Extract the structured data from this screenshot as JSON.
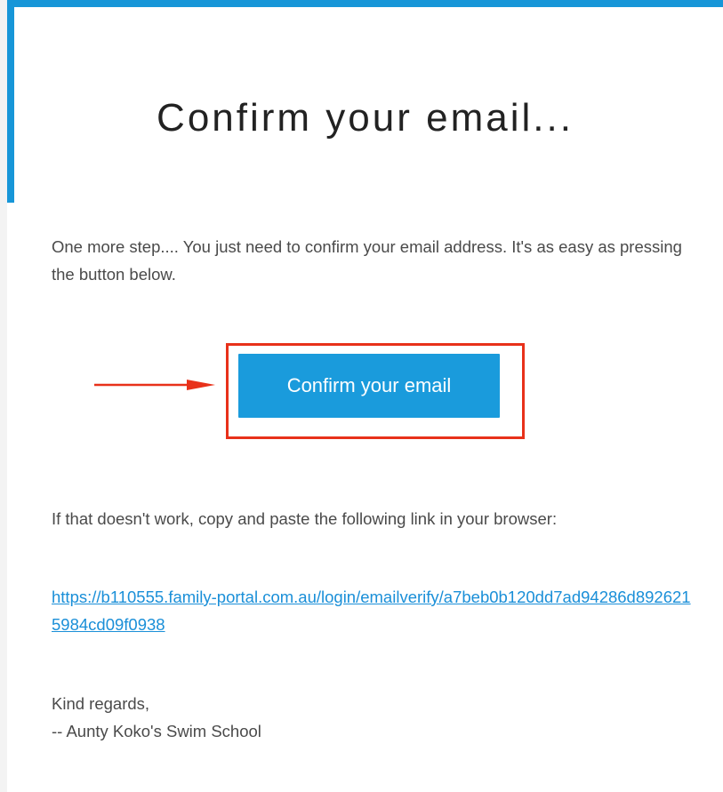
{
  "email": {
    "title": "Confirm your email...",
    "intro": "One more step.... You just need to confirm your email address. It's as easy as pressing the button below.",
    "button_label": "Confirm your email",
    "fallback_text": "If that doesn't work, copy and paste the following link in your browser:",
    "verify_link": "https://b110555.family-portal.com.au/login/emailverify/a7beb0b120dd7ad94286d8926215984cd09f0938",
    "signoff_line1": "Kind regards,",
    "signoff_line2": "-- Aunty Koko's Swim School"
  },
  "icons": {
    "annotation_arrow": "arrow-right-icon"
  },
  "colors": {
    "accent": "#1796d8",
    "button": "#1a9bdc",
    "highlight": "#e8311a",
    "link": "#1a8fd8",
    "text": "#4a4a4a"
  }
}
